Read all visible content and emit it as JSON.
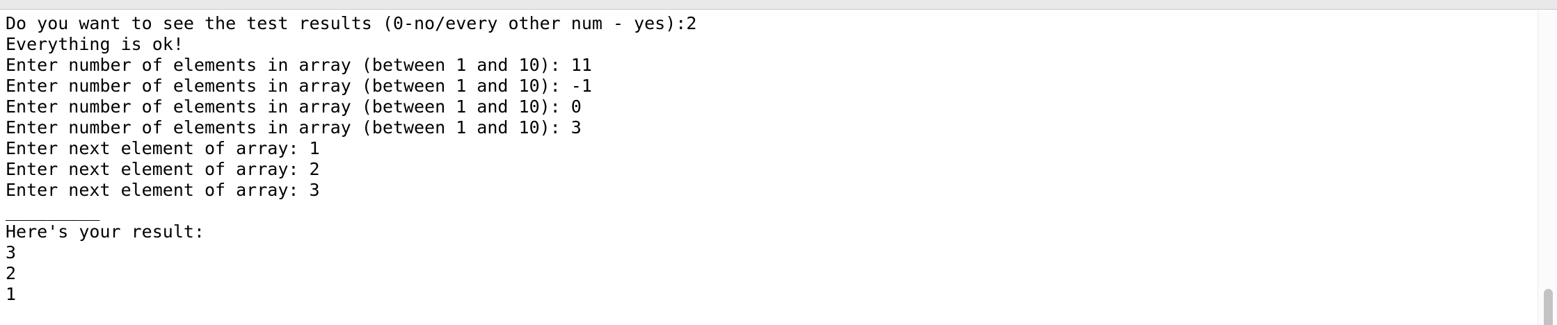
{
  "console": {
    "lines": [
      "Do you want to see the test results (0-no/every other num - yes):2",
      "Everything is ok!",
      "Enter number of elements in array (between 1 and 10): 11",
      "Enter number of elements in array (between 1 and 10): -1",
      "Enter number of elements in array (between 1 and 10): 0",
      "Enter number of elements in array (between 1 and 10): 3",
      "Enter next element of array: 1",
      "Enter next element of array: 2",
      "Enter next element of array: 3",
      "_________",
      "Here's your result:",
      "3",
      "2",
      "1"
    ]
  }
}
